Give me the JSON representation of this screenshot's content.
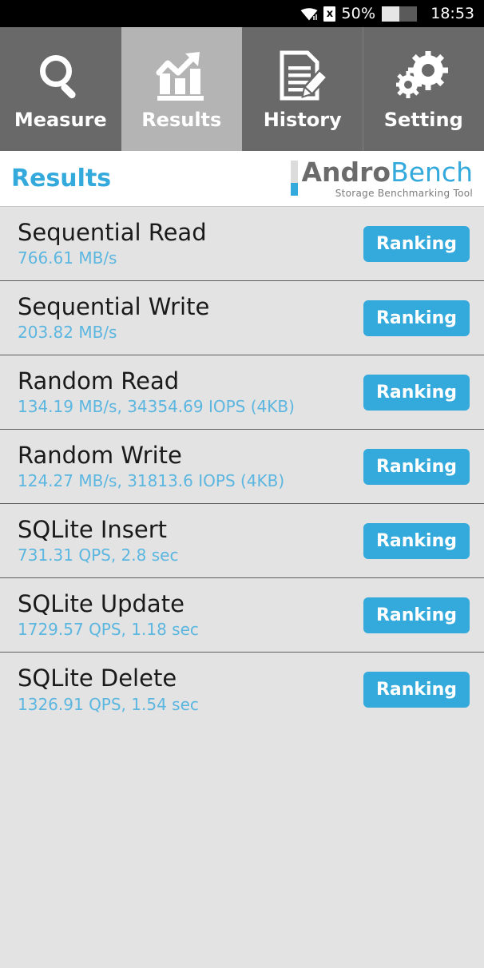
{
  "status_bar": {
    "wifi_icon": "wifi-icon",
    "sim_icon": "x",
    "battery_percent": "50%",
    "battery_icon": "battery-half-icon",
    "time": "18:53"
  },
  "tabs": [
    {
      "label": "Measure",
      "icon": "magnifier-icon",
      "active": false
    },
    {
      "label": "Results",
      "icon": "bar-chart-arrow-icon",
      "active": true
    },
    {
      "label": "History",
      "icon": "document-pencil-icon",
      "active": false
    },
    {
      "label": "Setting",
      "icon": "gears-icon",
      "active": false
    }
  ],
  "header": {
    "page_title": "Results",
    "logo_primary": "Andro",
    "logo_secondary": "Bench",
    "logo_tagline": "Storage Benchmarking Tool"
  },
  "colors": {
    "accent_blue": "#33a9dc",
    "value_blue": "#5bb6e0",
    "tab_bg": "#696969",
    "tab_active_bg": "#b4b4b4",
    "list_bg": "#e4e3e3",
    "status_bar_bg": "#000000"
  },
  "results": {
    "ranking_label": "Ranking",
    "rows": [
      {
        "title": "Sequential Read",
        "value": "766.61 MB/s"
      },
      {
        "title": "Sequential Write",
        "value": "203.82 MB/s"
      },
      {
        "title": "Random Read",
        "value": "134.19 MB/s, 34354.69 IOPS (4KB)"
      },
      {
        "title": "Random Write",
        "value": "124.27 MB/s, 31813.6 IOPS (4KB)"
      },
      {
        "title": "SQLite Insert",
        "value": "731.31 QPS, 2.8 sec"
      },
      {
        "title": "SQLite Update",
        "value": "1729.57 QPS, 1.18 sec"
      },
      {
        "title": "SQLite Delete",
        "value": "1326.91 QPS, 1.54 sec"
      }
    ]
  }
}
